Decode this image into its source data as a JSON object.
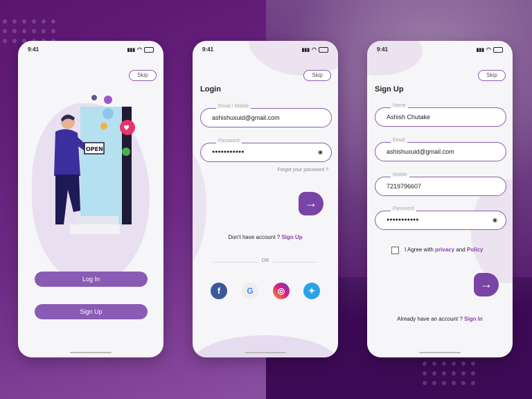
{
  "status_bar": {
    "time": "9:41"
  },
  "welcome": {
    "skip": "Skip",
    "sign_text": "OPEN",
    "login_button": "Log In",
    "signup_button": "Sign Up"
  },
  "login": {
    "skip": "Skip",
    "title": "Login",
    "email": {
      "label": "Email / Mobile",
      "value": "ashishuxuid@gmail.com"
    },
    "password": {
      "label": "Password",
      "value": "●●●●●●●●●●●"
    },
    "forgot": "Forgot your password ?",
    "no_account": "Don't have account ?",
    "signup_link": "Sign Up",
    "divider": "OR",
    "social": [
      "facebook-icon",
      "google-icon",
      "instagram-icon",
      "twitter-icon"
    ]
  },
  "signup": {
    "skip": "Skip",
    "title": "Sign Up",
    "name": {
      "label": "Name",
      "value": "Ashish Chutake"
    },
    "email": {
      "label": "Email",
      "value": "ashishuxuid@gmail.com"
    },
    "mobile": {
      "label": "Mobile",
      "value": "7219796607"
    },
    "password": {
      "label": "Password",
      "value": "●●●●●●●●●●●"
    },
    "agree_prefix": "I Agree with",
    "privacy": "privacy",
    "and": "and",
    "policy": "Policy",
    "have_account": "Already have an account ?",
    "signin_link": "Sign In"
  },
  "colors": {
    "accent": "#8c3fb0",
    "button": "#8a5bb5",
    "background_dark": "#5a1a6e"
  }
}
